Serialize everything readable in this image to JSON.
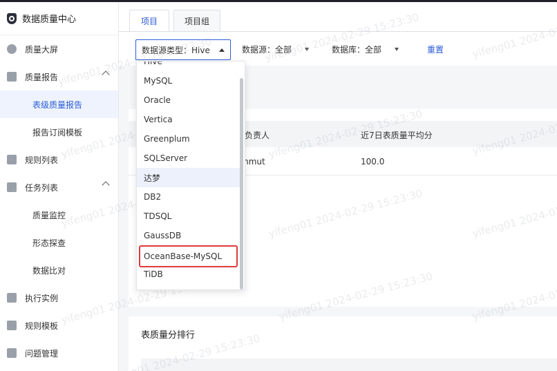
{
  "app": {
    "title": "数据质量中心"
  },
  "sidebar": {
    "items": [
      {
        "label": "质量大屏"
      },
      {
        "label": "质量报告"
      },
      {
        "label": "表级质量报告"
      },
      {
        "label": "报告订阅模板"
      },
      {
        "label": "规则列表"
      },
      {
        "label": "任务列表"
      },
      {
        "label": "质量监控"
      },
      {
        "label": "形态探查"
      },
      {
        "label": "数据比对"
      },
      {
        "label": "执行实例"
      },
      {
        "label": "规则模板"
      },
      {
        "label": "问题管理"
      }
    ]
  },
  "tabs": [
    {
      "label": "项目"
    },
    {
      "label": "项目组"
    }
  ],
  "filters": {
    "source_type": "数据源类型：Hive",
    "source": "数据源：全部",
    "database": "数据库：全部",
    "reset": "重置"
  },
  "table": {
    "headers": {
      "owner": "负责人",
      "avg_score": "近7日表质量平均分"
    },
    "row": {
      "owner": "mmut",
      "avg_score": "100.0"
    }
  },
  "ranking": {
    "title": "表质量分排行"
  },
  "dropdown": {
    "options": [
      "Hive",
      "MySQL",
      "Oracle",
      "Vertica",
      "Greenplum",
      "SQLServer",
      "达梦",
      "DB2",
      "TDSQL",
      "GaussDB",
      "OceanBase-MySQL",
      "TiDB"
    ],
    "hovered": "达梦",
    "boxed": "OceanBase-MySQL"
  },
  "watermark": "yifeng01 2024-02-29 15:23:30",
  "colors": {
    "accent": "#2a5bd7",
    "highlight_box": "#e03a3a"
  }
}
